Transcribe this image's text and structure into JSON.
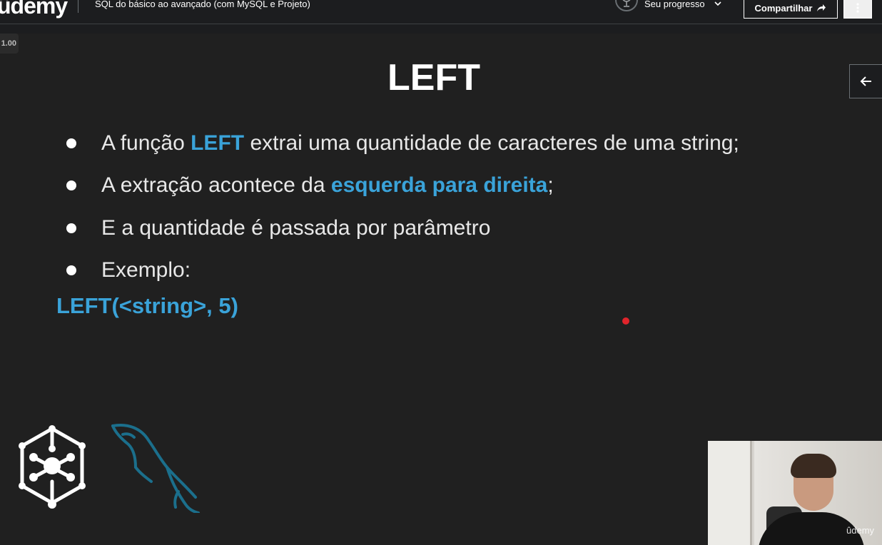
{
  "header": {
    "logo": "ûdemy",
    "course_title": "SQL do básico ao avançado (com MySQL e Projeto)",
    "progress_label": "Seu progresso",
    "share_label": "Compartilhar",
    "icons": {
      "progress": "trophy-icon",
      "chevron": "chevron-down-icon",
      "share": "share-arrow-icon",
      "more": "more-vertical-icon"
    }
  },
  "player": {
    "speed": "1.00",
    "side_button_icon": "arrow-left-icon"
  },
  "slide": {
    "title": "LEFT",
    "bullets": [
      {
        "before": "A função ",
        "highlight": "LEFT",
        "after": " extrai uma quantidade de caracteres de uma string;"
      },
      {
        "before": "A extração acontece da ",
        "highlight": "esquerda para direita",
        "after": ";"
      },
      {
        "before": "E a quantidade é passada por parâmetro",
        "highlight": "",
        "after": ""
      },
      {
        "before": "Exemplo:",
        "highlight": "",
        "after": ""
      }
    ],
    "example": "LEFT(<string>, 5)",
    "accent_color": "#3aa3d9",
    "logos": [
      "cube-network-logo",
      "mysql-dolphin-logo"
    ]
  },
  "webcam": {
    "watermark": "ûdemy"
  }
}
